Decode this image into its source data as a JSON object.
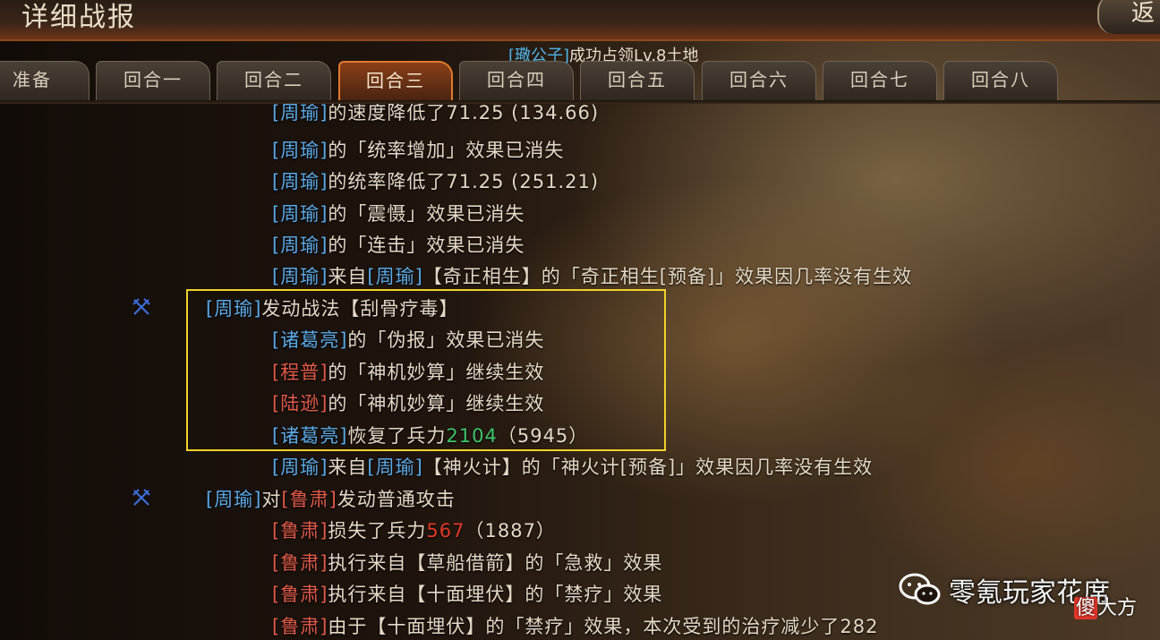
{
  "window": {
    "title": "详细战报",
    "close_label": "返"
  },
  "occupy": {
    "name": "[璥公子]",
    "text": "成功占领Lv.8土地"
  },
  "tabs": [
    "准备",
    "回合一",
    "回合二",
    "回合三",
    "回合四",
    "回合五",
    "回合六",
    "回合七",
    "回合八"
  ],
  "active_tab": "回合三",
  "log": {
    "l0": {
      "a": "[周瑜]",
      "b": "的速度降低了71.25 (134.66)"
    },
    "l1": {
      "a": "[周瑜]",
      "b": "的「统率增加」效果已消失"
    },
    "l2": {
      "a": "[周瑜]",
      "b": "的统率降低了71.25 (251.21)"
    },
    "l3": {
      "a": "[周瑜]",
      "b": "的「震慑」效果已消失"
    },
    "l4": {
      "a": "[周瑜]",
      "b": "的「连击」效果已消失"
    },
    "l5": {
      "a": "[周瑜]",
      "b": "来自",
      "c": "[周瑜]",
      "d": "【奇正相生】的「奇正相生[预备]」效果因几率没有生效"
    },
    "l6": {
      "a": "[周瑜]",
      "b": "发动战法【刮骨疗毒】"
    },
    "l7": {
      "a": "[诸葛亮]",
      "b": "的「伪报」效果已消失"
    },
    "l8": {
      "a": "[程普]",
      "b": "的「神机妙算」继续生效"
    },
    "l9": {
      "a": "[陆逊]",
      "b": "的「神机妙算」继续生效"
    },
    "l10": {
      "a": "[诸葛亮]",
      "b": "恢复了兵力",
      "c": "2104",
      "d": "（5945）"
    },
    "l11": {
      "a": "[周瑜]",
      "b": "来自",
      "c": "[周瑜]",
      "d": "【神火计】的「神火计[预备]」效果因几率没有生效"
    },
    "l12": {
      "a": "[周瑜]",
      "b": "对",
      "c": "[鲁肃]",
      "d": "发动普通攻击"
    },
    "l13": {
      "a": "[鲁肃]",
      "b": "损失了兵力",
      "c": "567",
      "d": "（1887）"
    },
    "l14": {
      "a": "[鲁肃]",
      "b": "执行来自【草船借箭】的「急救」效果"
    },
    "l15": {
      "a": "[鲁肃]",
      "b": "执行来自【十面埋伏】的「禁疗」效果"
    },
    "l16": {
      "a": "[鲁肃]",
      "b": "由于【十面埋伏】的「禁疗」效果，本次受到的治疗减少了282"
    }
  },
  "watermark": {
    "text": "零氪玩家花席",
    "sub_red": "傻",
    "sub": "大方"
  },
  "colors": {
    "ally_name": "#5aa9e6",
    "enemy_name": "#e05a4a",
    "heal": "#3ec46a",
    "damage": "#e23a2a",
    "highlight": "#f0d22a",
    "active_tab": "#e07a2e"
  }
}
